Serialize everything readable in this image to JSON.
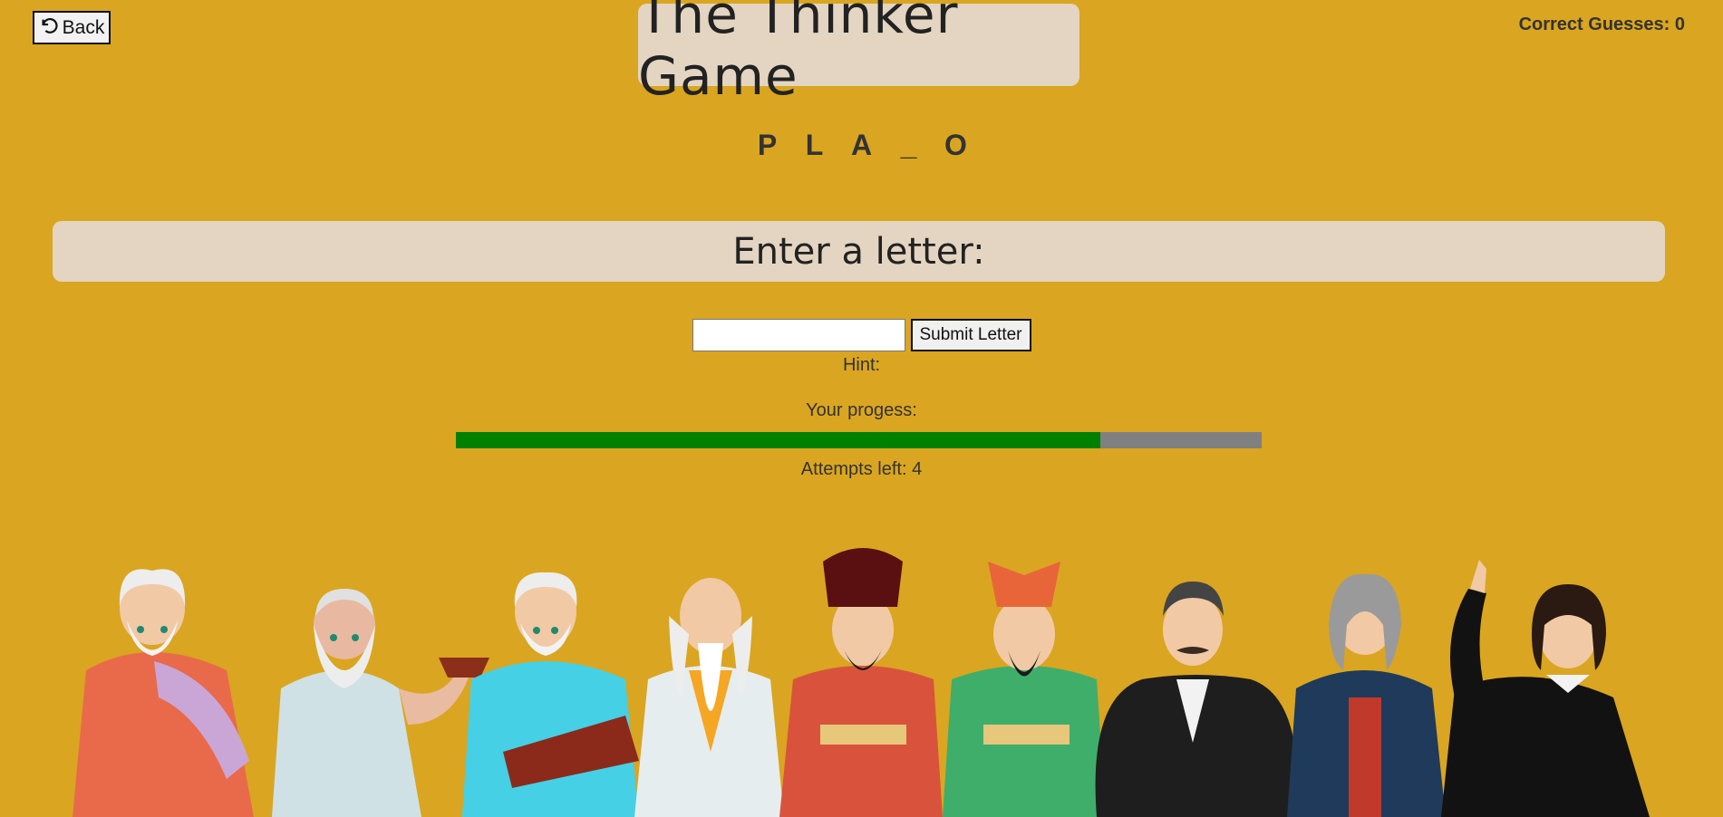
{
  "header": {
    "back_label": "Back",
    "score_label": "Correct Guesses: 0",
    "title": "The Thinker Game"
  },
  "puzzle": {
    "letters": [
      "P",
      "L",
      "A",
      "_",
      "O"
    ]
  },
  "prompt": {
    "heading": "Enter a letter:",
    "input_value": "",
    "input_placeholder": "",
    "submit_label": "Submit Letter"
  },
  "status": {
    "hint_label": "Hint:",
    "progress_label": "Your progess:",
    "progress_fraction": 0.8,
    "attempts_label": "Attempts left: 4"
  },
  "colors": {
    "background": "#DAA520",
    "panel": "#E3D5C1",
    "progress_fill": "#008000",
    "progress_track": "#808080"
  },
  "icons": {
    "back": "undo-arrow-icon"
  }
}
